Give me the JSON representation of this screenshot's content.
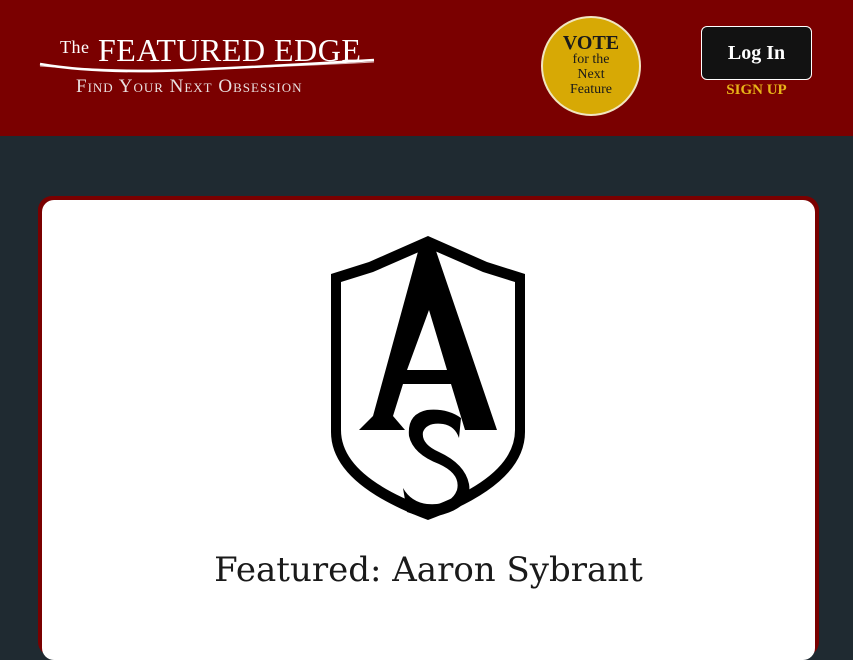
{
  "header": {
    "logo": {
      "the": "The",
      "main": "FEATURED EDGE",
      "tagline": "Find Your Next Obsession"
    },
    "vote": {
      "title": "VOTE",
      "line1": "for the",
      "line2": "Next",
      "line3": "Feature"
    },
    "login_label": "Log In",
    "signup_label": "SIGN UP"
  },
  "main": {
    "crest_icon": "shield-monogram-icon",
    "crest_letters": "AS",
    "title": "Featured: Aaron Sybrant"
  },
  "colors": {
    "header_bg": "#7a0000",
    "page_bg": "#1f2a31",
    "vote_gold": "#d7a905",
    "signup_gold": "#e8b418"
  }
}
